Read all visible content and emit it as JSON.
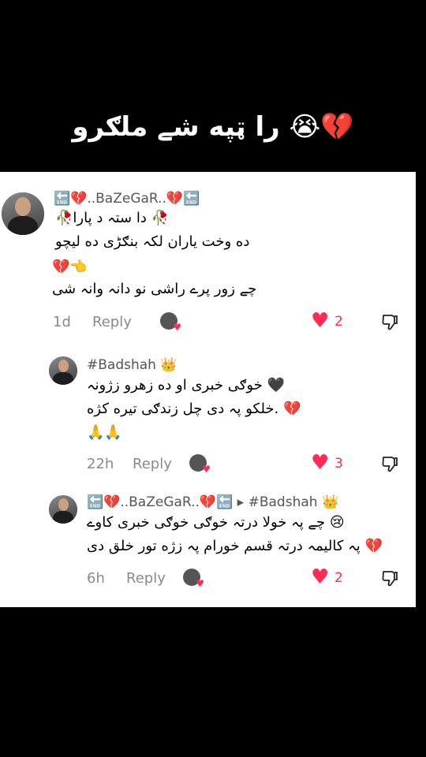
{
  "header": {
    "title": "را ټپه شے ملګرو 😭💔"
  },
  "comments": [
    {
      "username": "🔚💔..BaZeGaR..💔🔚",
      "lines": [
        "🥀دا ستہ د پارا 🥀",
        "ده وخت یاران لکہ بنګڑی ده لیچو",
        "💔👈",
        "چے زور پرے راشی نو دانہ وانہ شی"
      ],
      "time": "1d",
      "reply_label": "Reply",
      "likes": "2"
    },
    {
      "username": "#Badshah 👑",
      "lines": [
        "خوګی خبری او ده زهرو زژونہ 🖤",
        "خلکو پہ دی چل زندګی تیره کژه. 💔",
        "🙏🙏"
      ],
      "time": "22h",
      "reply_label": "Reply",
      "likes": "3"
    },
    {
      "username": "🔚💔..BaZeGaR..💔🔚 ▸ #Badshah 👑",
      "lines": [
        "چے پہ خولا درتہ خوګی خوګی خبری کاوے 😢",
        "پہ کالیمہ درتہ قسم خورام پہ زژه تور خلق دی 💔"
      ],
      "time": "6h",
      "reply_label": "Reply",
      "likes": "2"
    }
  ],
  "colors": {
    "accent": "#fe2c55",
    "background": "#000000",
    "card": "#ffffff"
  }
}
